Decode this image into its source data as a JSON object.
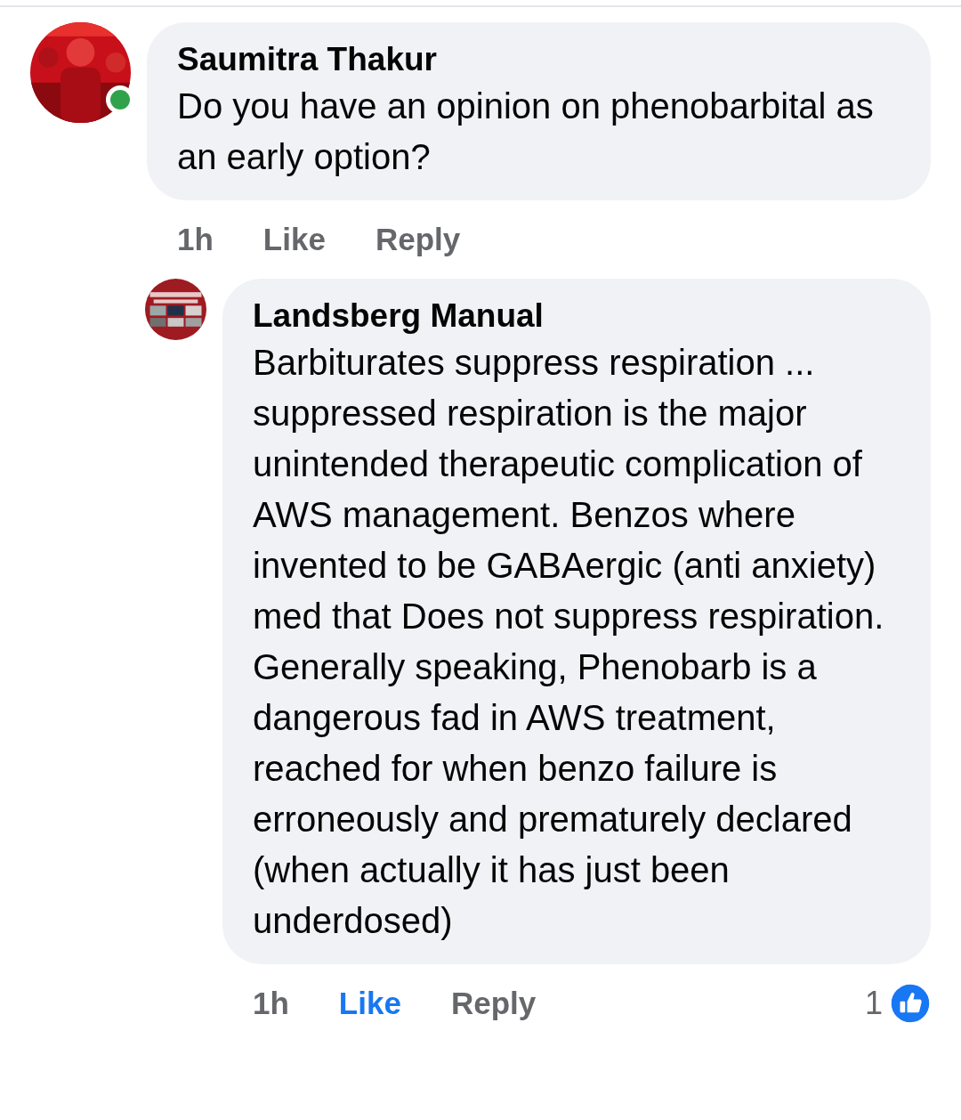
{
  "comments": [
    {
      "author": "Saumitra Thakur",
      "online": true,
      "text": "Do you have an opinion on phenobarbital as an early option?",
      "time": "1h",
      "actions": [
        {
          "label": "Like",
          "selected": false
        },
        {
          "label": "Reply",
          "selected": false
        }
      ],
      "replies": [
        {
          "author": "Landsberg Manual",
          "online": false,
          "text": "Barbiturates suppress respiration ... suppressed respiration is the major unintended therapeutic complication of AWS management. Benzos where invented to be GABAergic (anti anxiety) med that Does not suppress respiration. Generally speaking, Phenobarb is a dangerous fad in AWS treatment, reached for when benzo failure is erroneously and prematurely declared (when actually it has just been underdosed)",
          "time": "1h",
          "actions": [
            {
              "label": "Like",
              "selected": true
            },
            {
              "label": "Reply",
              "selected": false
            }
          ],
          "reaction_count": "1"
        }
      ]
    }
  ]
}
